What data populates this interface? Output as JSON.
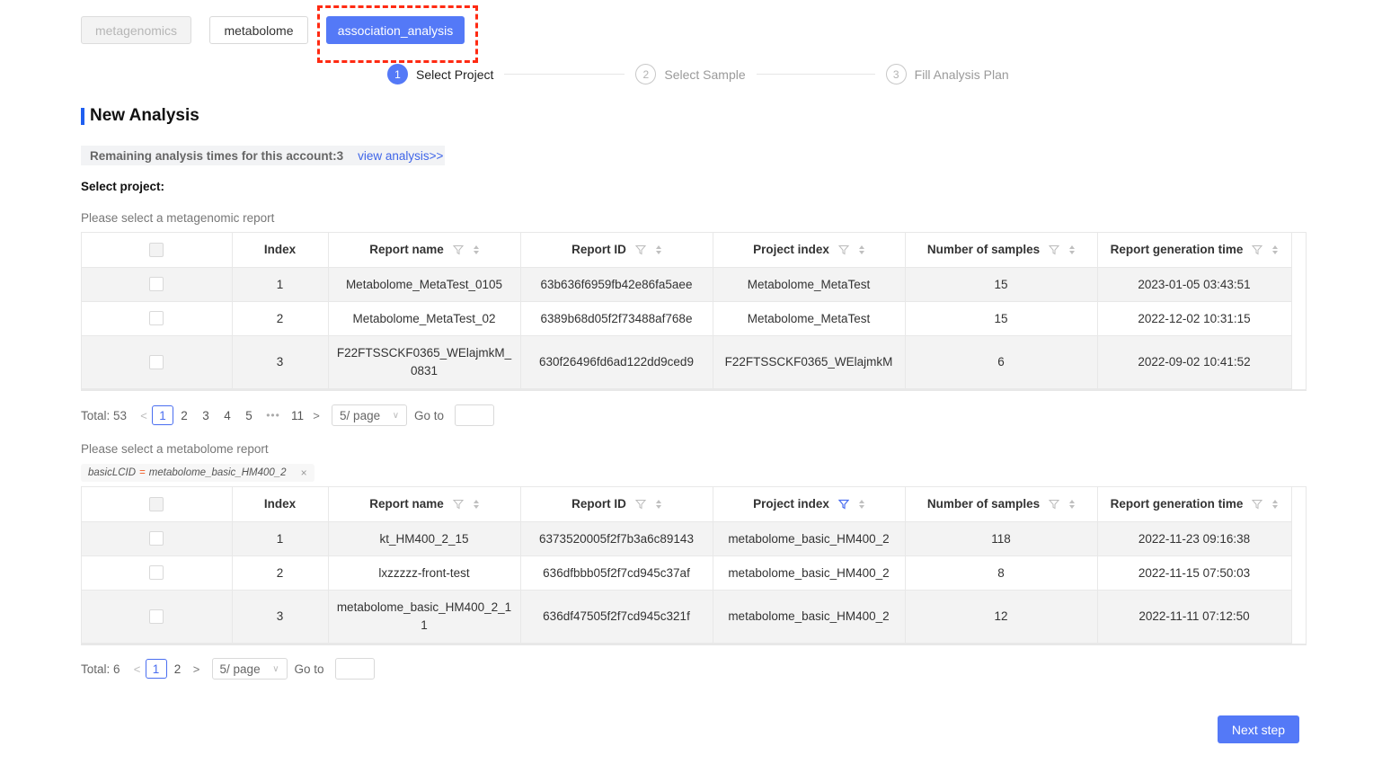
{
  "mode_tabs": [
    {
      "label": "metagenomics",
      "state": "disabled"
    },
    {
      "label": "metabolome",
      "state": "default"
    },
    {
      "label": "association_analysis",
      "state": "active"
    }
  ],
  "highlight_color": "#ff2a12",
  "accent_color": "#5479f7",
  "steps": [
    {
      "number": "1",
      "label": "Select Project",
      "active": true
    },
    {
      "number": "2",
      "label": "Select Sample",
      "active": false
    },
    {
      "number": "3",
      "label": "Fill Analysis Plan",
      "active": false
    }
  ],
  "page_title": "New Analysis",
  "notice": {
    "text": "Remaining analysis times for this account:3",
    "link": "view analysis>>"
  },
  "select_project_label": "Select project:",
  "columns": [
    "Index",
    "Report name",
    "Report ID",
    "Project index",
    "Number of samples",
    "Report generation time"
  ],
  "metagenomic": {
    "section_label": "Please select a metagenomic report",
    "rows": [
      {
        "index": "1",
        "report_name": "Metabolome_MetaTest_0105",
        "report_id": "63b636f6959fb42e86fa5aee",
        "project_index": "Metabolome_MetaTest",
        "samples": "15",
        "time": "2023-01-05 03:43:51"
      },
      {
        "index": "2",
        "report_name": "Metabolome_MetaTest_02",
        "report_id": "6389b68d05f2f73488af768e",
        "project_index": "Metabolome_MetaTest",
        "samples": "15",
        "time": "2022-12-02 10:31:15"
      },
      {
        "index": "3",
        "report_name": "F22FTSSCKF0365_WElajmkM_0831",
        "report_id": "630f26496fd6ad122dd9ced9",
        "project_index": "F22FTSSCKF0365_WElajmkM",
        "samples": "6",
        "time": "2022-09-02 10:41:52"
      }
    ],
    "pagination": {
      "total": "Total: 53",
      "pages": [
        "1",
        "2",
        "3",
        "4",
        "5",
        "•••",
        "11"
      ],
      "current": "1",
      "page_size": "5/ page",
      "goto_label": "Go to",
      "goto_value": ""
    }
  },
  "metabolome": {
    "section_label": "Please select a metabolome report",
    "filter_tag": {
      "key": "basicLCID",
      "op": "=",
      "value": "metabolome_basic_HM400_2",
      "close": "×"
    },
    "rows": [
      {
        "index": "1",
        "report_name": "kt_HM400_2_15",
        "report_id": "6373520005f2f7b3a6c89143",
        "project_index": "metabolome_basic_HM400_2",
        "samples": "118",
        "time": "2022-11-23 09:16:38"
      },
      {
        "index": "2",
        "report_name": "lxzzzzz-front-test",
        "report_id": "636dfbbb05f2f7cd945c37af",
        "project_index": "metabolome_basic_HM400_2",
        "samples": "8",
        "time": "2022-11-15 07:50:03"
      },
      {
        "index": "3",
        "report_name": "metabolome_basic_HM400_2_11",
        "report_id": "636df47505f2f7cd945c321f",
        "project_index": "metabolome_basic_HM400_2",
        "samples": "12",
        "time": "2022-11-11 07:12:50"
      }
    ],
    "pagination": {
      "total": "Total: 6",
      "pages": [
        "1",
        "2"
      ],
      "current": "1",
      "page_size": "5/ page",
      "goto_label": "Go to",
      "goto_value": ""
    }
  },
  "next_button": "Next step"
}
